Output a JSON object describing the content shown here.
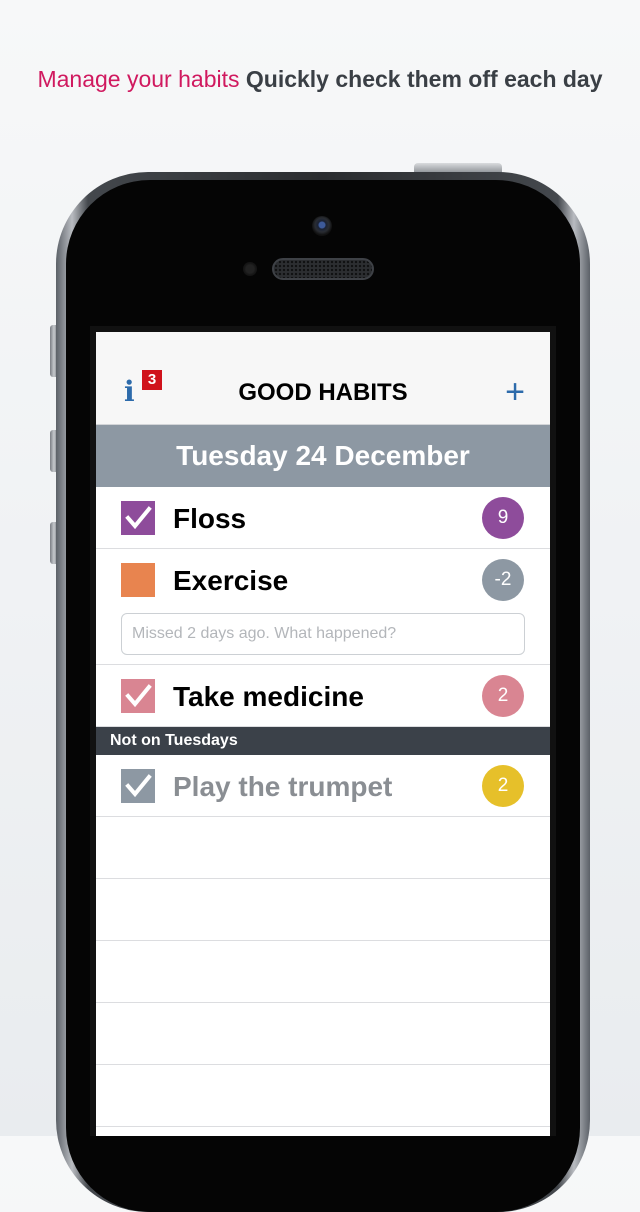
{
  "caption": {
    "lead": "Manage your habits",
    "rest": "Quickly check them off each day"
  },
  "app": {
    "nav": {
      "info_icon": "i",
      "badge_count": "3",
      "title": "GOOD HABITS",
      "add_icon": "+"
    },
    "date_header": "Tuesday 24 December",
    "habits": [
      {
        "name": "Floss",
        "checked": true,
        "color": "#8e4c9b",
        "streak": "9",
        "streak_color": "#8e4c9b"
      },
      {
        "name": "Exercise",
        "checked": false,
        "color": "#e8844f",
        "streak": "-2",
        "streak_color": "#8d98a3",
        "note_placeholder": "Missed 2 days ago. What happened?"
      },
      {
        "name": "Take medicine",
        "checked": true,
        "color": "#d98592",
        "streak": "2",
        "streak_color": "#d98592"
      }
    ],
    "section": {
      "title": "Not on Tuesdays",
      "habits": [
        {
          "name": "Play the trumpet",
          "checked": true,
          "color": "#8d98a3",
          "streak": "2",
          "streak_color": "#e6c02a"
        }
      ]
    }
  }
}
